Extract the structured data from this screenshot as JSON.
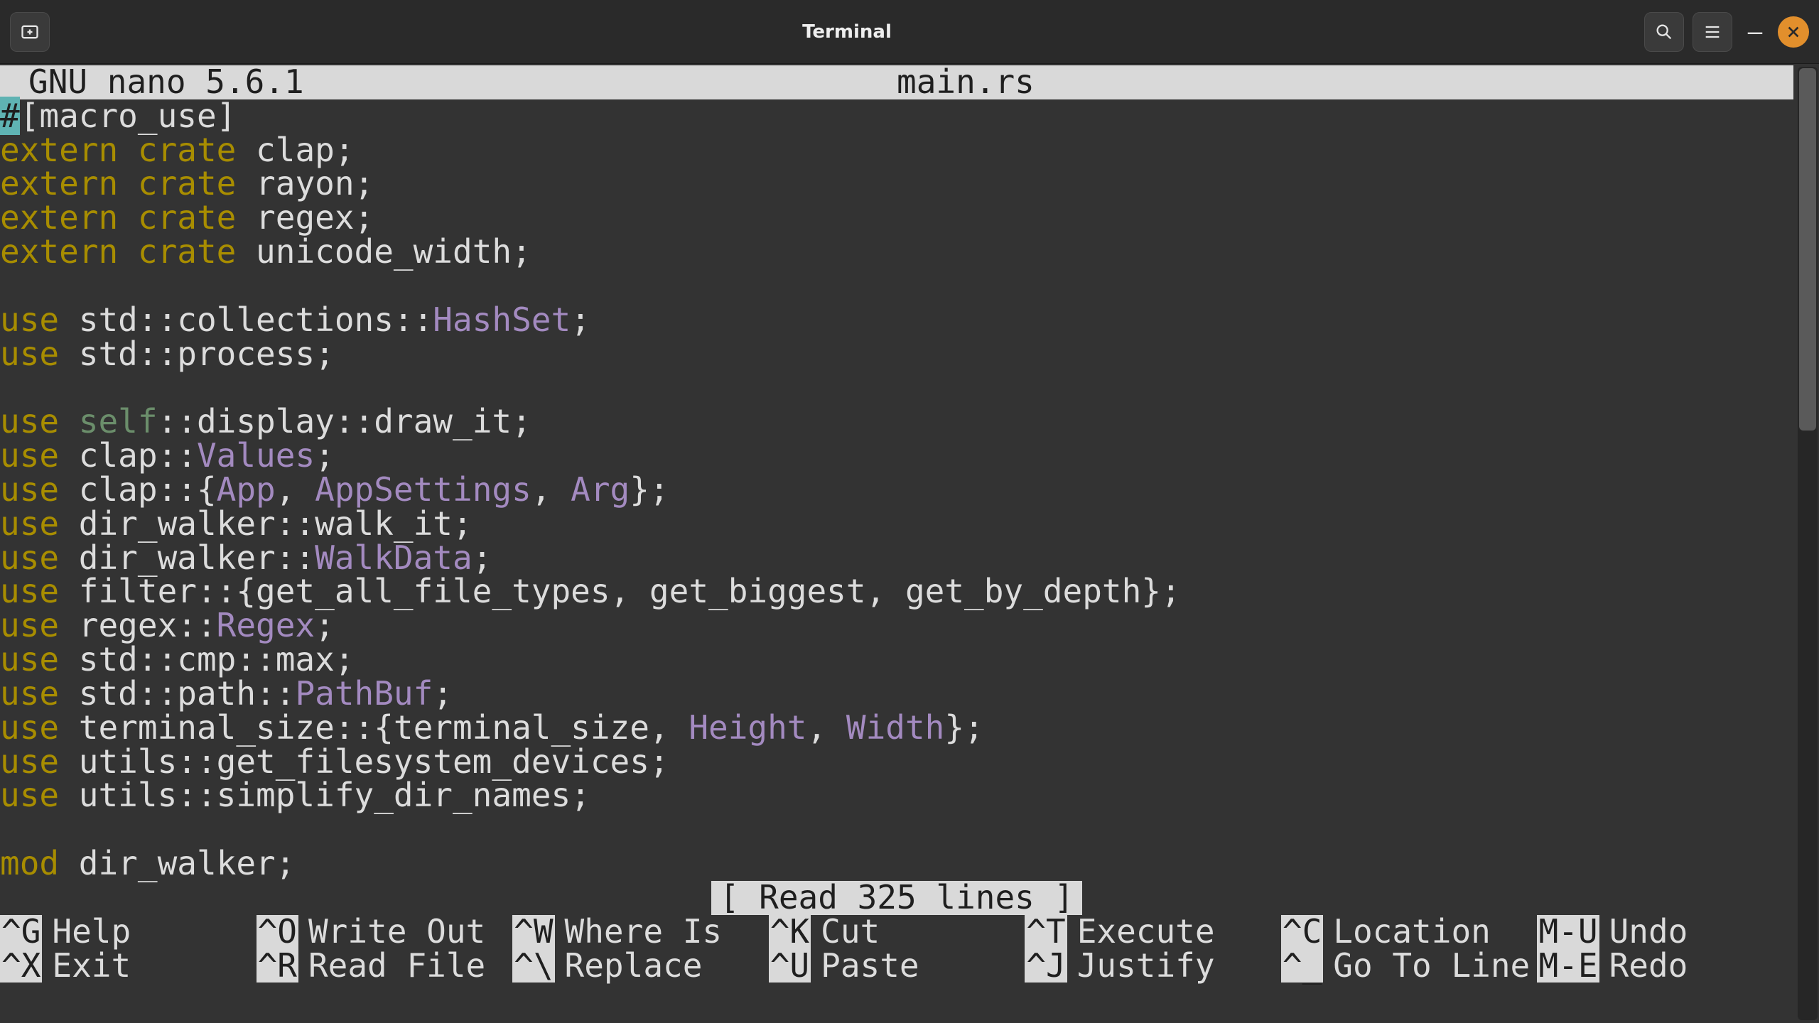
{
  "window": {
    "title": "Terminal"
  },
  "nano": {
    "header_left": "GNU nano 5.6.1",
    "header_file": "main.rs",
    "status": "[ Read 325 lines ]"
  },
  "code": {
    "l1_hash": "#",
    "l1_rest": "[macro_use]",
    "extern": "extern",
    "crate": "crate",
    "l2_rest": " clap;",
    "l3_rest": " rayon;",
    "l4_rest": " regex;",
    "l5_rest": " unicode_width;",
    "use": "use",
    "mod": "mod",
    "self": "self",
    "l6_a": " std::collections::",
    "l6_b": "HashSet",
    "l6_c": ";",
    "l7_a": " std::process;",
    "l8_a": " ",
    "l8_b": "::display::draw_it;",
    "l9_a": " clap::",
    "l9_b": "Values",
    "l9_c": ";",
    "l10_a": " clap::{",
    "l10_b": "App",
    "l10_c": ", ",
    "l10_d": "AppSettings",
    "l10_e": ", ",
    "l10_f": "Arg",
    "l10_g": "};",
    "l11_a": " dir_walker::walk_it;",
    "l12_a": " dir_walker::",
    "l12_b": "WalkData",
    "l12_c": ";",
    "l13_a": " filter::{get_all_file_types, get_biggest, get_by_depth};",
    "l14_a": " regex::",
    "l14_b": "Regex",
    "l14_c": ";",
    "l15_a": " std::cmp::max;",
    "l16_a": " std::path::",
    "l16_b": "PathBuf",
    "l16_c": ";",
    "l17_a": " terminal_size::{terminal_size, ",
    "l17_b": "Height",
    "l17_c": ", ",
    "l17_d": "Width",
    "l17_e": "};",
    "l18_a": " utils::get_filesystem_devices;",
    "l19_a": " utils::simplify_dir_names;",
    "l20_a": " dir_walker;"
  },
  "help": {
    "r1": {
      "c1_k": "^G",
      "c1_l": "Help",
      "c2_k": "^O",
      "c2_l": "Write Out",
      "c3_k": "^W",
      "c3_l": "Where Is",
      "c4_k": "^K",
      "c4_l": "Cut",
      "c5_k": "^T",
      "c5_l": "Execute",
      "c6_k": "^C",
      "c6_l": "Location",
      "c7_k": "M-U",
      "c7_l": "Undo"
    },
    "r2": {
      "c1_k": "^X",
      "c1_l": "Exit",
      "c2_k": "^R",
      "c2_l": "Read File",
      "c3_k": "^\\",
      "c3_l": "Replace",
      "c4_k": "^U",
      "c4_l": "Paste",
      "c5_k": "^J",
      "c5_l": "Justify",
      "c6_k": "^_",
      "c6_l": "Go To Line",
      "c7_k": "M-E",
      "c7_l": "Redo"
    }
  }
}
